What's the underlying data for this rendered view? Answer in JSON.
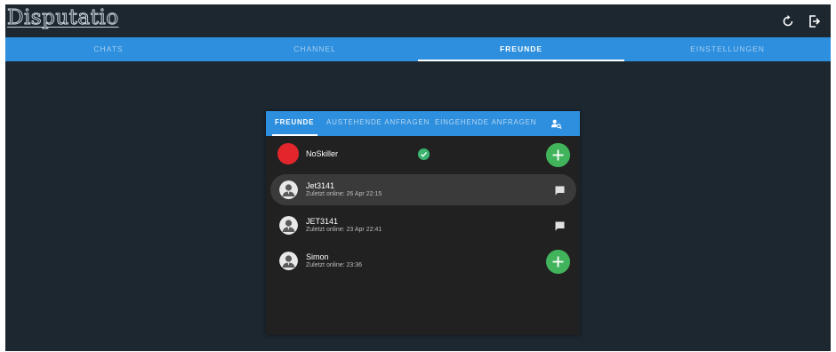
{
  "app": {
    "title": "Disputatio",
    "icons": [
      "refresh-icon",
      "logout-icon"
    ]
  },
  "nav": {
    "tabs": [
      {
        "label": "CHATS",
        "active": false
      },
      {
        "label": "CHANNEL",
        "active": false
      },
      {
        "label": "FREUNDE",
        "active": true
      },
      {
        "label": "EINSTELLUNGEN",
        "active": false
      }
    ]
  },
  "friends_panel": {
    "tabs": [
      {
        "label": "FREUNDE",
        "active": true
      },
      {
        "label": "AUSTEHENDE ANFRAGEN",
        "active": false
      },
      {
        "label": "EINGEHENDE ANFRAGEN",
        "active": false
      }
    ],
    "search_icon": "person-search-icon",
    "rows": [
      {
        "name": "NoSkiller",
        "status": "",
        "avatar": "red",
        "badge": "check",
        "action": "add"
      },
      {
        "name": "Jet3141",
        "status": "Zuletzt online: 26 Apr 22:15",
        "avatar": "user",
        "action": "chat",
        "highlight": true
      },
      {
        "name": "JET3141",
        "status": "Zuletzt online: 23 Apr 22:41",
        "avatar": "user",
        "action": "chat"
      },
      {
        "name": "Simon",
        "status": "Zuletzt online: 23:36",
        "avatar": "user",
        "action": "add"
      }
    ]
  },
  "colors": {
    "background": "#1c2730",
    "primary": "#2d8fde",
    "panel": "#212121",
    "accent_green": "#41b35b",
    "avatar_red": "#e2262c"
  }
}
